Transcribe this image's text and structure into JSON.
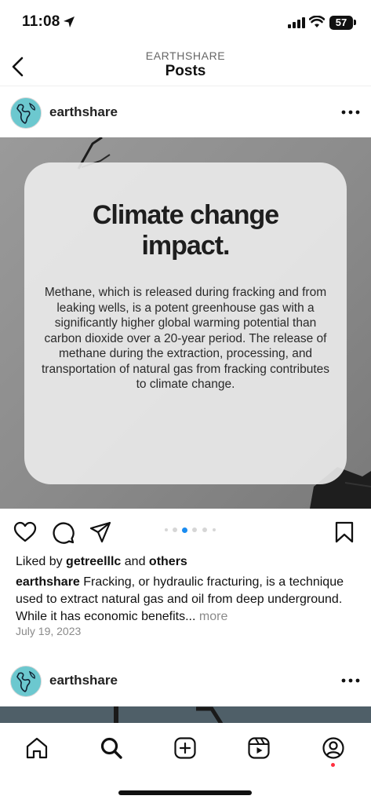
{
  "status_bar": {
    "time": "11:08",
    "battery": "57"
  },
  "header": {
    "account": "EARTHSHARE",
    "title": "Posts"
  },
  "post": {
    "username": "earthshare",
    "slide": {
      "title_line1": "Climate change",
      "title_line2": "impact.",
      "body": "Methane, which is released during fracking and from leaking wells, is a potent greenhouse gas with a significantly higher global warming potential than carbon dioxide over a 20-year period. The release of methane during the extraction, processing, and transportation of natural gas from fracking contributes to climate change."
    },
    "carousel": {
      "count": 6,
      "active_index": 2
    },
    "liked_by_prefix": "Liked by",
    "liked_by_user": "getreelllc",
    "liked_by_and": "and",
    "liked_by_others": "others",
    "caption_user": "earthshare",
    "caption_text": " Fracking, or hydraulic fracturing, is a technique used to extract natural gas and oil from deep underground. While it has economic benefits...",
    "more_label": "more",
    "date": "July 19, 2023"
  },
  "post2": {
    "username": "earthshare"
  },
  "nav": {
    "items": [
      {
        "name": "home",
        "icon": "home-icon"
      },
      {
        "name": "search",
        "icon": "search-icon"
      },
      {
        "name": "create",
        "icon": "plus-square-icon"
      },
      {
        "name": "reels",
        "icon": "reels-icon"
      },
      {
        "name": "profile",
        "icon": "profile-icon"
      }
    ],
    "notification_color": "#ff3040"
  },
  "colors": {
    "accent": "#1a8cf0",
    "muted": "#8a8a8a"
  }
}
